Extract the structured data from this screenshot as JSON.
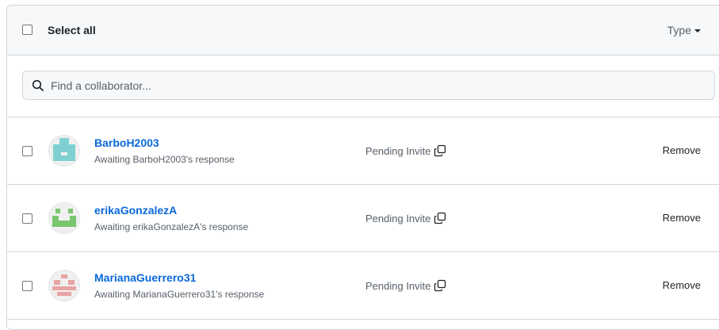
{
  "header": {
    "select_all_label": "Select all",
    "type_filter_label": "Type"
  },
  "search": {
    "placeholder": "Find a collaborator..."
  },
  "collaborators": [
    {
      "login": "BarboH2003",
      "status": "Awaiting BarboH2003's response",
      "invite_state": "Pending Invite",
      "remove_label": "Remove",
      "avatar_color": "#7fd1d1",
      "avatar_icon": "identicon-teal"
    },
    {
      "login": "erikaGonzalezA",
      "status": "Awaiting erikaGonzalezA's response",
      "invite_state": "Pending Invite",
      "remove_label": "Remove",
      "avatar_color": "#79c66f",
      "avatar_icon": "identicon-green"
    },
    {
      "login": "MarianaGuerrero31",
      "status": "Awaiting MarianaGuerrero31's response",
      "invite_state": "Pending Invite",
      "remove_label": "Remove",
      "avatar_color": "#e8a3a3",
      "avatar_icon": "identicon-pink"
    }
  ],
  "colors": {
    "link": "#0969da",
    "muted": "#57606a",
    "border": "#d0d7de",
    "header_bg": "#f6f8fa"
  }
}
